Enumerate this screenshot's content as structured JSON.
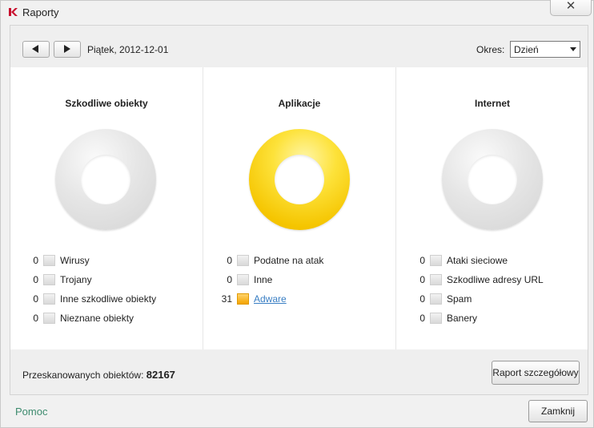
{
  "window": {
    "title": "Raporty",
    "close_symbol": "✕",
    "logo_icon": "kaspersky-k-icon"
  },
  "toolbar": {
    "prev_icon": "arrow-left-icon",
    "next_icon": "arrow-right-icon",
    "date": "Piątek, 2012-12-01",
    "period_label": "Okres:",
    "period_value": "Dzień"
  },
  "panels": [
    {
      "title": "Szkodliwe obiekty",
      "color": "#e0e0e0",
      "items": [
        {
          "count": "0",
          "label": "Wirusy"
        },
        {
          "count": "0",
          "label": "Trojany"
        },
        {
          "count": "0",
          "label": "Inne szkodliwe obiekty"
        },
        {
          "count": "0",
          "label": "Nieznane obiekty"
        }
      ]
    },
    {
      "title": "Aplikacje",
      "color": "#f5c500",
      "items": [
        {
          "count": "0",
          "label": "Podatne na atak"
        },
        {
          "count": "0",
          "label": "Inne"
        },
        {
          "count": "31",
          "label": "Adware"
        }
      ]
    },
    {
      "title": "Internet",
      "color": "#e0e0e0",
      "items": [
        {
          "count": "0",
          "label": "Ataki sieciowe"
        },
        {
          "count": "0",
          "label": "Szkodliwe adresy URL"
        },
        {
          "count": "0",
          "label": "Spam"
        },
        {
          "count": "0",
          "label": "Banery"
        }
      ]
    }
  ],
  "footer": {
    "scanned_label": "Przeskanowanych obiektów:",
    "scanned_value": "82167",
    "report_button": "Raport szczegółowy"
  },
  "bottom": {
    "help": "Pomoc",
    "close_button": "Zamknij"
  }
}
